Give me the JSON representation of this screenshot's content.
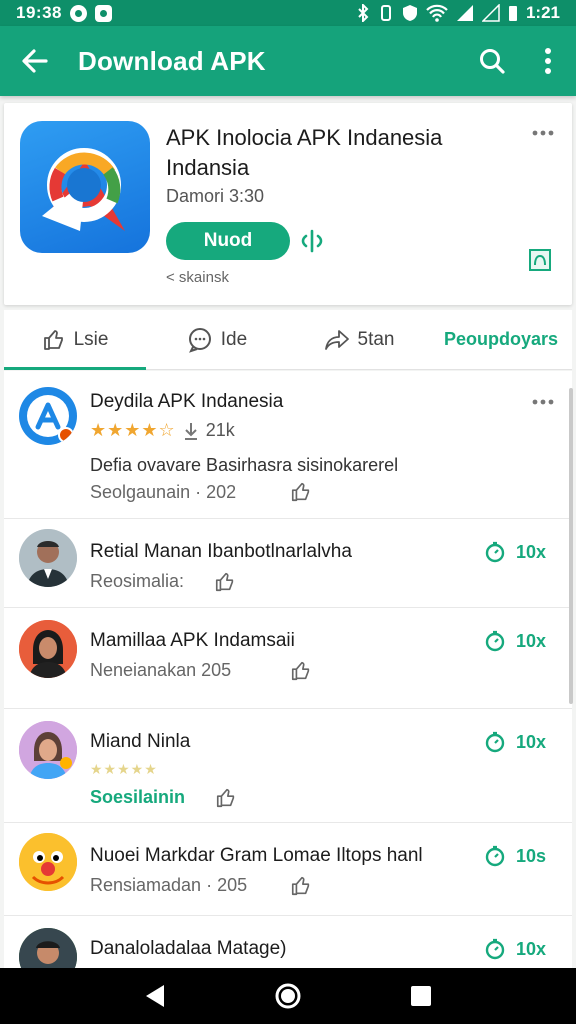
{
  "status_bar": {
    "time": "19:38",
    "clock": "1:21"
  },
  "app_bar": {
    "title": "Download APK"
  },
  "app": {
    "name": "APK Inolocia APK Indanesia Indansia",
    "developer": "Damori 3:30",
    "install_label": "Nuod",
    "meta": "< skainsk"
  },
  "tabs": [
    {
      "label": "Lsie"
    },
    {
      "label": "Ide"
    },
    {
      "label": "5tan"
    },
    {
      "label": "Peoupdoyars"
    }
  ],
  "featured": {
    "name": "Deydila APK Indanesia",
    "rating_count": "21k",
    "description": "Defia ovavare Basirhasra sisinokarerel",
    "meta": "Seolgaunain · 202"
  },
  "reviews": [
    {
      "name": "Retial Manan Ibanbotlnarlalvha",
      "meta": "Reosimalia:",
      "count": "10x"
    },
    {
      "name": "Mamillaa APK Indamsaii",
      "meta": "Neneianakan  205",
      "count": "10x"
    },
    {
      "name": "Miand Ninla",
      "meta": "Soesilainin",
      "count": "10x"
    },
    {
      "name": "Nuoei Markdar Gram Lomae Iltops hanl",
      "meta": "Rensiamadan · 205",
      "count": "10s"
    },
    {
      "name": "Danaloladalaa Matage)",
      "count": "10x"
    }
  ],
  "colors": {
    "primary": "#15a37b",
    "status_bar": "#0e8f69",
    "accent": "#16a97d",
    "star": "#f0a630"
  }
}
